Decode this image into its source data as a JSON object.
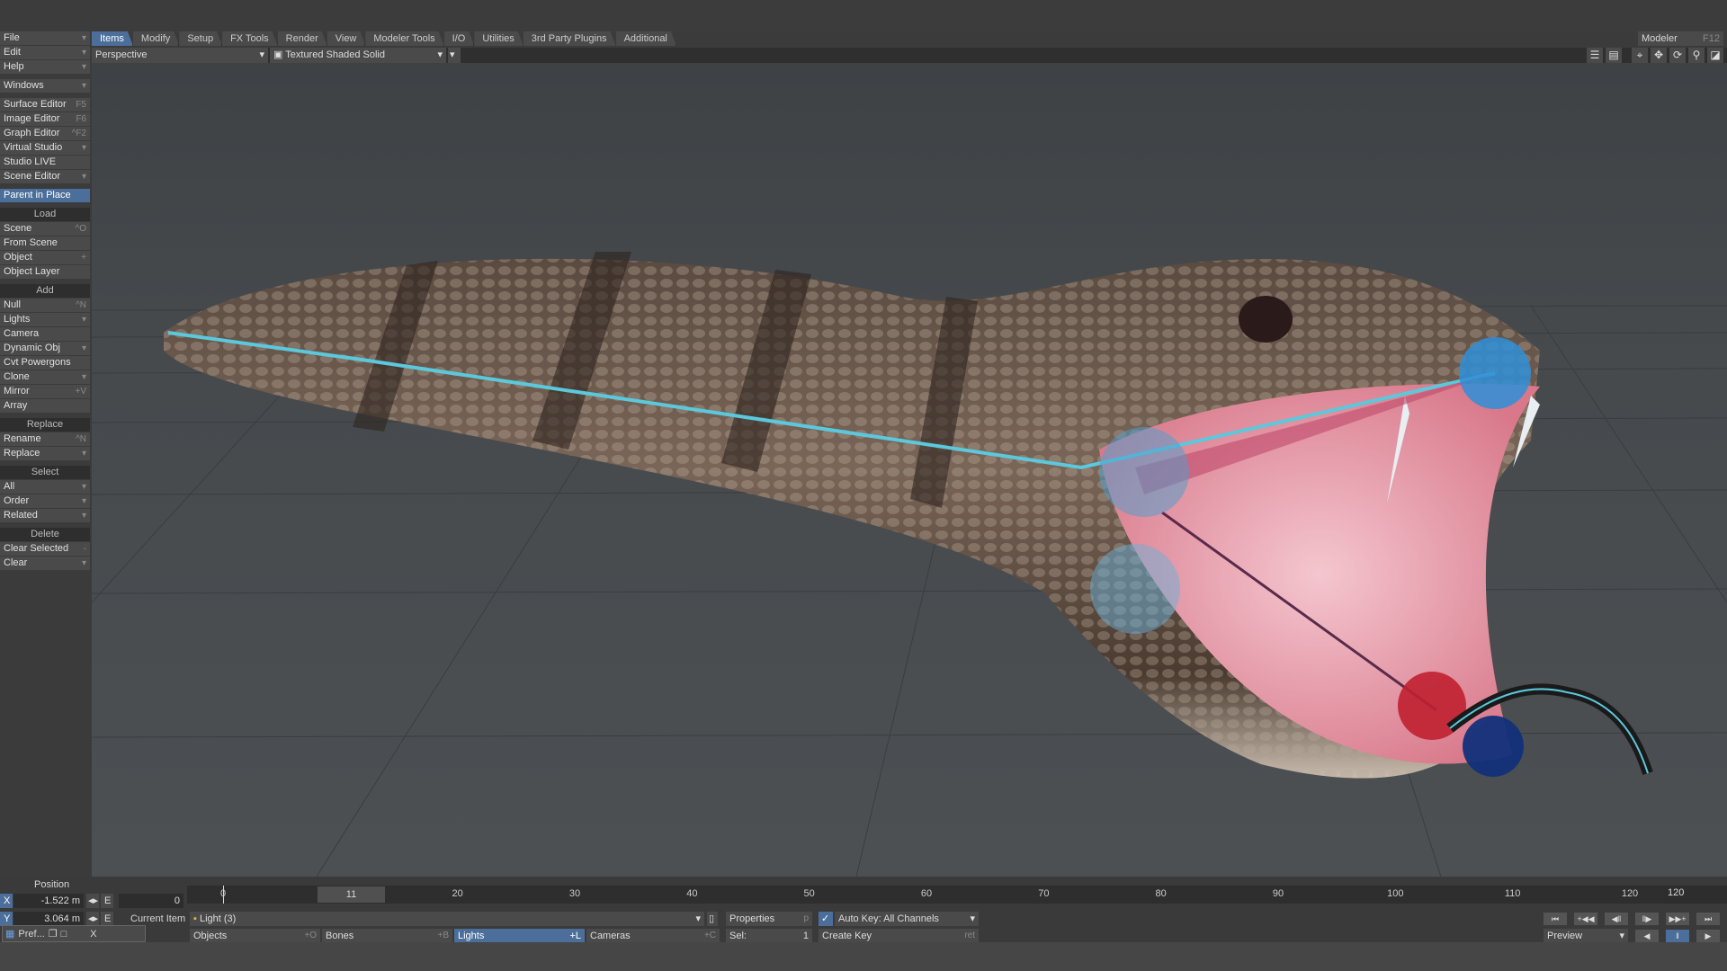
{
  "tabs": [
    "Items",
    "Modify",
    "Setup",
    "FX Tools",
    "Render",
    "View",
    "Modeler Tools",
    "I/O",
    "Utilities",
    "3rd Party Plugins",
    "Additional"
  ],
  "modeler": {
    "label": "Modeler",
    "key": "F12"
  },
  "viewbar": {
    "view": "Perspective",
    "render": "Textured Shaded Solid"
  },
  "sidebar": {
    "top": [
      {
        "l": "File",
        "k": "▾"
      },
      {
        "l": "Edit",
        "k": "▾"
      },
      {
        "l": "Help",
        "k": "▾"
      }
    ],
    "windows": {
      "l": "Windows",
      "k": "▾"
    },
    "editors": [
      {
        "l": "Surface Editor",
        "k": "F5"
      },
      {
        "l": "Image Editor",
        "k": "F6"
      },
      {
        "l": "Graph Editor",
        "k": "^F2"
      },
      {
        "l": "Virtual Studio",
        "k": "▾"
      },
      {
        "l": "Studio LIVE",
        "k": ""
      },
      {
        "l": "Scene Editor",
        "k": "▾"
      }
    ],
    "parent": "Parent in Place",
    "load": {
      "h": "Load",
      "items": [
        {
          "l": "Scene",
          "k": "^O"
        },
        {
          "l": "From Scene",
          "k": ""
        },
        {
          "l": "Object",
          "k": "+"
        },
        {
          "l": "Object Layer",
          "k": ""
        }
      ]
    },
    "add": {
      "h": "Add",
      "items": [
        {
          "l": "Null",
          "k": "^N"
        },
        {
          "l": "Lights",
          "k": "▾"
        },
        {
          "l": "Camera",
          "k": ""
        },
        {
          "l": "Dynamic Obj",
          "k": "▾"
        },
        {
          "l": "Cvt Powergons",
          "k": ""
        },
        {
          "l": "Clone",
          "k": "▾"
        },
        {
          "l": "Mirror",
          "k": "+V"
        },
        {
          "l": "Array",
          "k": ""
        }
      ]
    },
    "replace": {
      "h": "Replace",
      "items": [
        {
          "l": "Rename",
          "k": "^N"
        },
        {
          "l": "Replace",
          "k": "▾"
        }
      ]
    },
    "select": {
      "h": "Select",
      "items": [
        {
          "l": "All",
          "k": "▾"
        },
        {
          "l": "Order",
          "k": "▾"
        },
        {
          "l": "Related",
          "k": "▾"
        }
      ]
    },
    "delete": {
      "h": "Delete",
      "items": [
        {
          "l": "Clear Selected",
          "k": "-"
        },
        {
          "l": "Clear",
          "k": "▾"
        }
      ]
    }
  },
  "bottom": {
    "position": "Position",
    "x_label": "X",
    "x": "-1.522 m",
    "y_label": "Y",
    "y": "3.064 m",
    "e": "E",
    "frame_start": "0",
    "current_frame": "11",
    "frame_end": "120",
    "ticks": [
      "0",
      "20",
      "30",
      "40",
      "50",
      "60",
      "70",
      "80",
      "90",
      "100",
      "110",
      "120"
    ],
    "current_item_label": "Current Item",
    "current_item": "Light (3)",
    "properties": "Properties",
    "properties_key": "p",
    "autokey": "Auto Key: All Channels",
    "create_key": "Create Key",
    "create_key_k": "ret",
    "objects": "Objects",
    "objects_k": "+O",
    "bones": "Bones",
    "bones_k": "+B",
    "lights": "Lights",
    "lights_k": "+L",
    "cameras": "Cameras",
    "cameras_k": "+C",
    "sel_label": "Sel:",
    "sel": "1",
    "preview": "Preview",
    "pref": "Pref...",
    "close": "X"
  }
}
